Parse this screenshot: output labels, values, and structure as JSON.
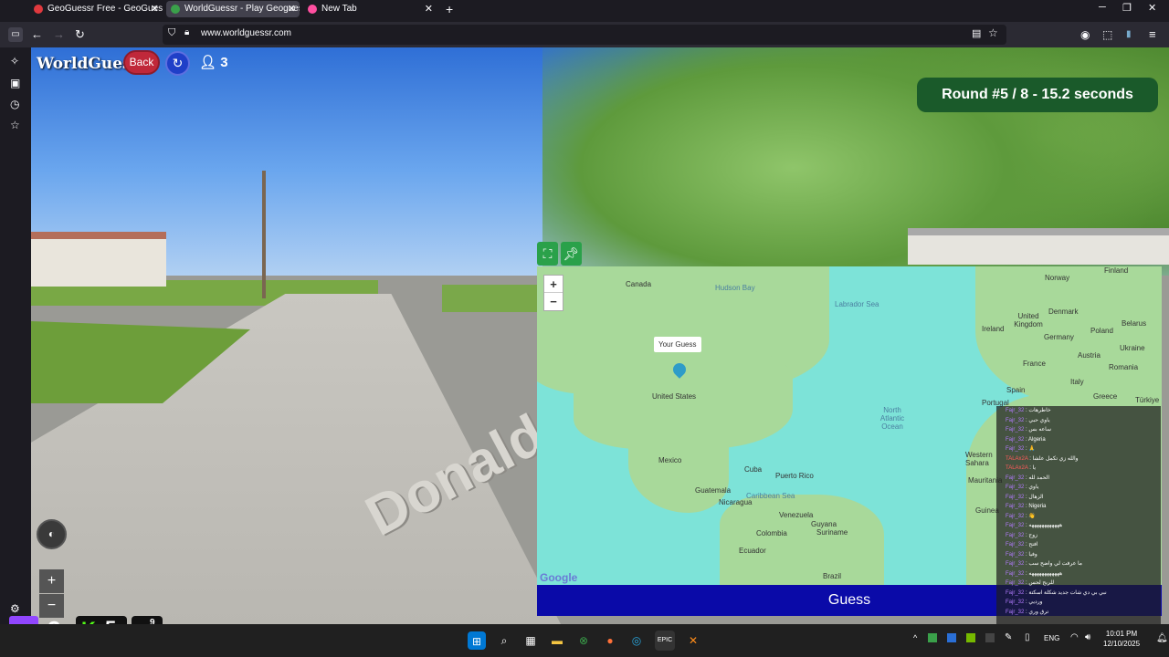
{
  "browser": {
    "tabs": [
      {
        "label": "GeoGuessr Free - GeoGuessr",
        "active": false,
        "favicon_color": "#e0393e"
      },
      {
        "label": "WorldGuessr - Play Geoguessr Free",
        "active": true,
        "favicon_color": "#3aa04a"
      },
      {
        "label": "New Tab",
        "active": false,
        "favicon_color": "#ff4fa0"
      }
    ],
    "url_domain": "www.worldguessr.com",
    "url_prefix": "www."
  },
  "game": {
    "logo": "WorldGuessr",
    "back_label": "Back",
    "player_count": "3",
    "round_text": "Round #5 / 8 - 15.2 seconds",
    "street_sign": "Donald St",
    "map_tooltip": "Your Guess",
    "guess_label": "Guess",
    "google_label": "Google"
  },
  "map_labels": [
    {
      "t": "Canada"
    },
    {
      "t": "Hudson Bay"
    },
    {
      "t": "Labrador Sea"
    },
    {
      "t": "United States"
    },
    {
      "t": "Mexico"
    },
    {
      "t": "Cuba"
    },
    {
      "t": "Puerto Rico"
    },
    {
      "t": "Guatemala"
    },
    {
      "t": "Nicaragua"
    },
    {
      "t": "Caribbean Sea"
    },
    {
      "t": "Venezuela"
    },
    {
      "t": "Guyana"
    },
    {
      "t": "Suriname"
    },
    {
      "t": "Colombia"
    },
    {
      "t": "Ecuador"
    },
    {
      "t": "Brazil"
    },
    {
      "t": "North Atlantic Ocean"
    },
    {
      "t": "Norway"
    },
    {
      "t": "Finland"
    },
    {
      "t": "United Kingdom"
    },
    {
      "t": "Denmark"
    },
    {
      "t": "Ireland"
    },
    {
      "t": "Poland"
    },
    {
      "t": "Belarus"
    },
    {
      "t": "Germany"
    },
    {
      "t": "Ukraine"
    },
    {
      "t": "France"
    },
    {
      "t": "Austria"
    },
    {
      "t": "Romania"
    },
    {
      "t": "Spain"
    },
    {
      "t": "Italy"
    },
    {
      "t": "Portugal"
    },
    {
      "t": "Greece"
    },
    {
      "t": "Türkiye"
    },
    {
      "t": "Western Sahara"
    },
    {
      "t": "Mauritania"
    },
    {
      "t": "Guinea"
    }
  ],
  "chat": [
    {
      "user": "Fajr_32",
      "msg": "خاطرهات"
    },
    {
      "user": "Fajr_32",
      "msg": "ياوي حبي"
    },
    {
      "user": "Fajr_32",
      "msg": "ساعه بس"
    },
    {
      "user": "Fajr_32",
      "msg": "Algeria"
    },
    {
      "user": "Fajr_32",
      "msg": "🙏"
    },
    {
      "user": "TALAx2A",
      "msg": "والله زي تكمل علشا"
    },
    {
      "user": "TALAx2A",
      "msg": "يا"
    },
    {
      "user": "Fajr_32",
      "msg": "الحمد لله"
    },
    {
      "user": "Fajr_32",
      "msg": "ياوي"
    },
    {
      "user": "Fajr_32",
      "msg": "الزهال"
    },
    {
      "user": "Fajr_32",
      "msg": "Nigeria"
    },
    {
      "user": "Fajr_32",
      "msg": "👋"
    },
    {
      "user": "Fajr_32",
      "msg": "ههههههههههههه"
    },
    {
      "user": "Fajr_32",
      "msg": "زوج"
    },
    {
      "user": "Fajr_32",
      "msg": "افتح"
    },
    {
      "user": "Fajr_32",
      "msg": "وفيا"
    },
    {
      "user": "Fajr_32",
      "msg": "ما عرفت لي واضح سب"
    },
    {
      "user": "Fajr_32",
      "msg": "ههههههههههههه"
    },
    {
      "user": "Fajr_32",
      "msg": "للربح لحس"
    },
    {
      "user": "Fajr_32",
      "msg": "نبي بي دي شات جديد شكلة اسكتة"
    },
    {
      "user": "Fajr_32",
      "msg": "ورديي"
    },
    {
      "user": "Fajr_32",
      "msg": "ترق وري"
    }
  ],
  "overlay": {
    "twitch_count": "3",
    "kick_count": "5",
    "viewers_a": "9",
    "viewers_b": "4"
  },
  "taskbar": {
    "icons": [
      "windows-icon",
      "search-icon",
      "store-icon",
      "folder-icon",
      "xbox-icon",
      "firefox-icon",
      "edge-icon",
      "epic-icon",
      "app-icon"
    ],
    "lang": "ENG",
    "time": "10:01 PM",
    "date": "12/10/2025"
  }
}
